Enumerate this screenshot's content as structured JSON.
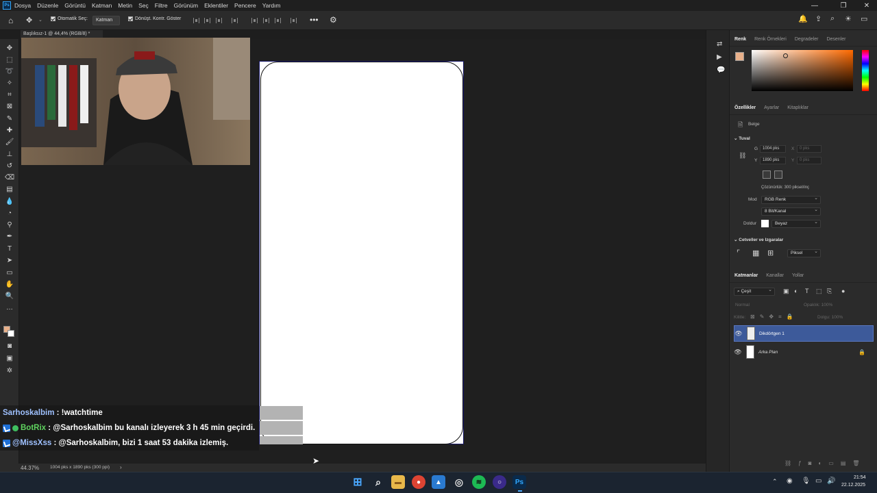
{
  "menu": [
    "Dosya",
    "Düzenle",
    "Görüntü",
    "Katman",
    "Metin",
    "Seç",
    "Filtre",
    "Görünüm",
    "Eklentiler",
    "Pencere",
    "Yardım"
  ],
  "options": {
    "auto_select": "Otomatik Seç:",
    "target": "Katman",
    "show_transform": "Dönüşt. Kontr. Göster"
  },
  "doc_tab": "Başlıksız-1 @ 44,4% (RGB/8) *",
  "chat": [
    {
      "user": "Sarhoskalbim",
      "user_color": "#9fc1ff",
      "message": ": !watchtime"
    },
    {
      "user": "BotRix",
      "user_color": "#5fd35f",
      "message": ": @Sarhoskalbim bu kanalı izleyerek 3 h 45 min geçirdi."
    },
    {
      "user": "@MissXss",
      "user_color": "#9fc1ff",
      "message": ": @Sarhoskalbim, bizi 1 saat 53 dakika izlemiş."
    }
  ],
  "status": {
    "zoom": "44.37%",
    "doc_info": "1004 pks x 1890 pks (300 ppi)"
  },
  "color_panel": {
    "tabs": [
      "Renk",
      "Renk Örnekleri",
      "Degradeler",
      "Desenler"
    ],
    "fg": "#e8b08a",
    "hue": "#ff6a00"
  },
  "properties": {
    "tabs": [
      "Özellikler",
      "Ayarlar",
      "Kitaplıklar"
    ],
    "doc_label": "Belge",
    "canvas_title": "Tuval",
    "w_label": "G",
    "w_value": "1004 pks",
    "h_label": "Y",
    "h_value": "1890 pks",
    "x_label": "X",
    "x_value": "0 pks",
    "y_label": "Y",
    "y_value": "0 pks",
    "resolution": "Çözünürlük: 300 piksel/inç",
    "mode_label": "Mod",
    "mode": "RGB Renk",
    "depth": "8 Bit/Kanal",
    "fill_label": "Doldur",
    "fill": "Beyaz",
    "rulers_title": "Cetveller ve Izgaralar",
    "unit": "Piksel"
  },
  "layers": {
    "tabs": [
      "Katmanlar",
      "Kanallar",
      "Yollar"
    ],
    "filter": "Çeşit",
    "blend": "Normal",
    "opacity": "Opaklık: 100%",
    "lock_label": "Kilitle:",
    "fill": "Dolgu: 100%",
    "items": [
      {
        "name": "Dikdörtgen 1",
        "selected": true
      },
      {
        "name": "Arka Plan",
        "selected": false
      }
    ]
  },
  "clock": {
    "time": "21:54",
    "date": "22.12.2025"
  }
}
